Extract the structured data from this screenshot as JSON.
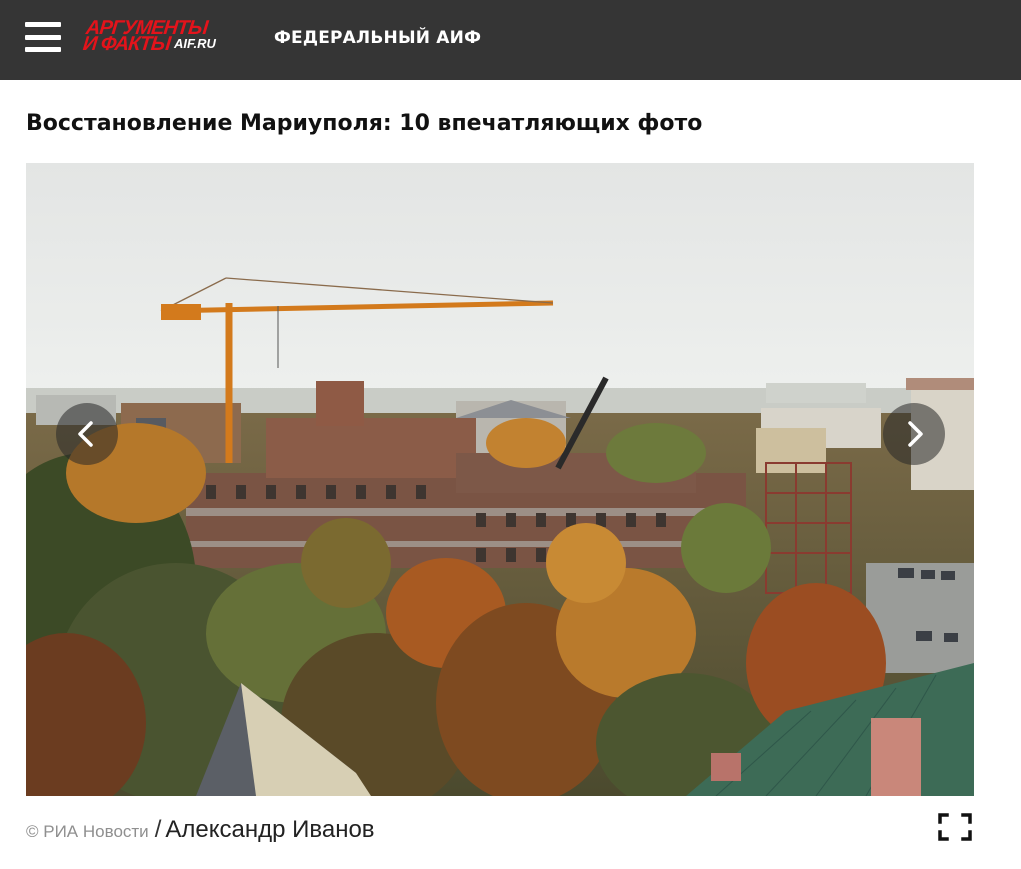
{
  "header": {
    "menu_icon": "hamburger-menu-icon",
    "logo": {
      "line1": "АРГУМЕНТЫ",
      "line2": "И ФАКТЫ",
      "site": "AIF.RU",
      "brand_color": "#e3131b"
    },
    "section_label": "ФЕДЕРАЛЬНЫЙ АИФ",
    "background_color": "#353535"
  },
  "article": {
    "title": "Восстановление Мариуполя: 10 впечатляющих фото"
  },
  "gallery": {
    "prev_icon": "chevron-left-icon",
    "next_icon": "chevron-right-icon",
    "photo_credit_source": "© РИА Новости",
    "photo_credit_separator": "/",
    "photo_credit_author": "Александр Иванов",
    "fullscreen_icon": "fullscreen-corners-icon"
  }
}
